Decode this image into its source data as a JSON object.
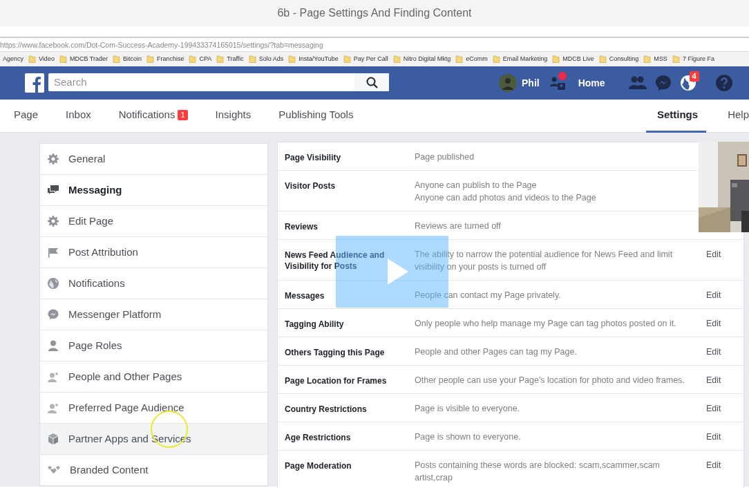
{
  "video": {
    "title": "6b - Page Settings And Finding Content"
  },
  "browser": {
    "url": "https://www.facebook.com/Dot-Com-Success-Academy-199433374165015/settings/?tab=messaging",
    "bookmarks": [
      {
        "label": "Agency",
        "kind": "plain"
      },
      {
        "label": "Video",
        "kind": "folder"
      },
      {
        "label": "MDCB Trader",
        "kind": "folder"
      },
      {
        "label": "Bitcoin",
        "kind": "folder"
      },
      {
        "label": "Franchise",
        "kind": "folder"
      },
      {
        "label": "CPA",
        "kind": "folder"
      },
      {
        "label": "Traffic",
        "kind": "folder"
      },
      {
        "label": "Solo Ads",
        "kind": "folder"
      },
      {
        "label": "Insta/YouTube",
        "kind": "folder"
      },
      {
        "label": "Pay Per Call",
        "kind": "folder"
      },
      {
        "label": "Nitro Digital Mktg",
        "kind": "folder"
      },
      {
        "label": "eComm",
        "kind": "folder"
      },
      {
        "label": "Email Marketing",
        "kind": "folder"
      },
      {
        "label": "MDCB Live",
        "kind": "folder"
      },
      {
        "label": "Consulting",
        "kind": "folder"
      },
      {
        "label": "MSS",
        "kind": "folder"
      },
      {
        "label": "7 Figure Fa",
        "kind": "folder"
      }
    ]
  },
  "topbar": {
    "search": {
      "placeholder": "Search"
    },
    "user": "Phil",
    "friend_requests_alert": true,
    "home": "Home",
    "notifications_badge": "4"
  },
  "page_tabs": [
    {
      "label": "Page",
      "selected": false
    },
    {
      "label": "Inbox",
      "selected": false
    },
    {
      "label": "Notifications",
      "selected": false,
      "badge": "1"
    },
    {
      "label": "Insights",
      "selected": false
    },
    {
      "label": "Publishing Tools",
      "selected": false
    }
  ],
  "right_tabs": [
    {
      "label": "Settings",
      "selected": true
    },
    {
      "label": "Help",
      "selected": false
    }
  ],
  "sidebar": {
    "items": [
      {
        "label": "General",
        "kind": "gear",
        "selected": false,
        "hovered": false
      },
      {
        "label": "Messaging",
        "kind": "chat",
        "selected": true,
        "hovered": false
      },
      {
        "label": "Edit Page",
        "kind": "gear",
        "selected": false,
        "hovered": false
      },
      {
        "label": "Post Attribution",
        "kind": "flag",
        "selected": false,
        "hovered": false
      },
      {
        "label": "Notifications",
        "kind": "globe",
        "selected": false,
        "hovered": false
      },
      {
        "label": "Messenger Platform",
        "kind": "messenger",
        "selected": false,
        "hovered": false
      },
      {
        "label": "Page Roles",
        "kind": "person",
        "selected": false,
        "hovered": false
      },
      {
        "label": "People and Other Pages",
        "kind": "person-star",
        "selected": false,
        "hovered": false
      },
      {
        "label": "Preferred Page Audience",
        "kind": "person-star",
        "selected": false,
        "hovered": false
      },
      {
        "label": "Partner Apps and Services",
        "kind": "cube",
        "selected": false,
        "hovered": true
      },
      {
        "label": "Branded Content",
        "kind": "handshake",
        "selected": false,
        "hovered": false
      }
    ]
  },
  "settings": {
    "rows": [
      {
        "label": "Page Visibility",
        "lines": [
          "Page published"
        ]
      },
      {
        "label": "Visitor Posts",
        "lines": [
          "Anyone can publish to the Page",
          "Anyone can add photos and videos to the Page"
        ]
      },
      {
        "label": "Reviews",
        "lines": [
          "Reviews are turned off"
        ]
      },
      {
        "label": "News Feed Audience and Visibility for Posts",
        "lines": [
          "The ability to narrow the potential audience for News Feed and limit",
          "visibility on your posts is turned off"
        ],
        "edit": "Edit"
      },
      {
        "label": "Messages",
        "lines": [
          "People can contact my Page privately."
        ],
        "edit": "Edit"
      },
      {
        "label": "Tagging Ability",
        "lines": [
          "Only people who help manage my Page can tag photos posted on it."
        ],
        "edit": "Edit"
      },
      {
        "label": "Others Tagging this Page",
        "lines": [
          "People and other Pages can tag my Page."
        ],
        "edit": "Edit"
      },
      {
        "label": "Page Location for Frames",
        "lines": [
          "Other people can use your Page's location for photo and video frames."
        ],
        "edit": "Edit"
      },
      {
        "label": "Country Restrictions",
        "lines": [
          "Page is visible to everyone."
        ],
        "edit": "Edit"
      },
      {
        "label": "Age Restrictions",
        "lines": [
          "Page is shown to everyone."
        ],
        "edit": "Edit"
      },
      {
        "label": "Page Moderation",
        "lines": [
          "Posts containing these words are blocked: scam,scammer,scam",
          "artist,crap"
        ],
        "edit": "Edit"
      }
    ]
  }
}
